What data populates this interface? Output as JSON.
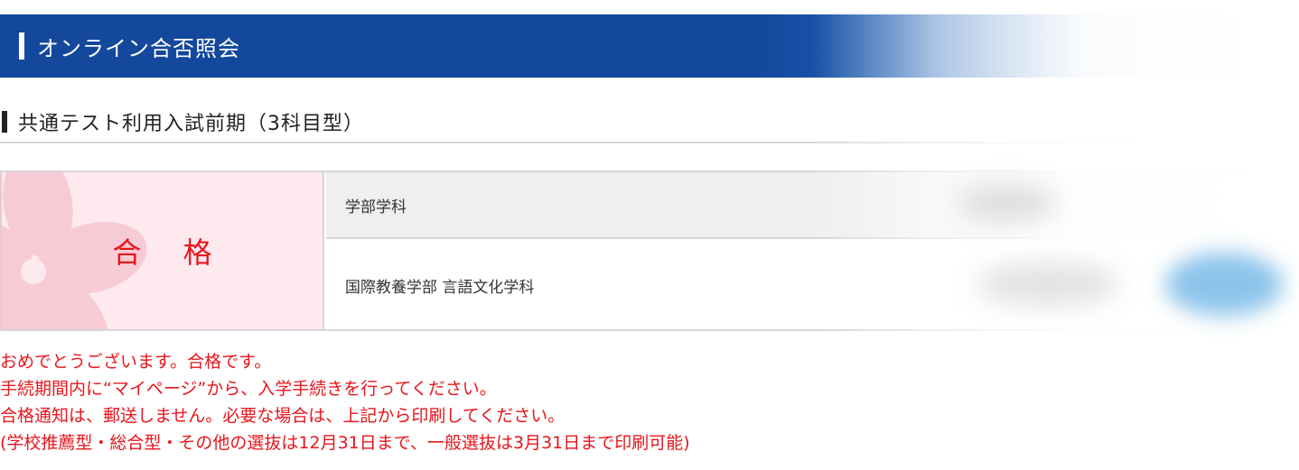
{
  "header": {
    "title": "オンライン合否照会"
  },
  "section": {
    "title": "共通テスト利用入試前期（3科目型）"
  },
  "result": {
    "status": "合 格",
    "table": {
      "header_label": "学部学科",
      "department": "国際教養学部 言語文化学科"
    }
  },
  "messages": [
    "おめでとうございます。合格です。",
    "手続期間内に“マイページ”から、入学手続きを行ってください。",
    "合格通知は、郵送しません。必要な場合は、上記から印刷してください。",
    "(学校推薦型・総合型・その他の選抜は12月31日まで、一般選抜は3月31日まで印刷可能)"
  ],
  "colors": {
    "header_bg": "#13489c",
    "result_red": "#e8151b",
    "result_bg": "#fde9ee",
    "flower": "#f6c6d2"
  },
  "icons": {
    "result_bg": "sakura-flower-icon"
  }
}
